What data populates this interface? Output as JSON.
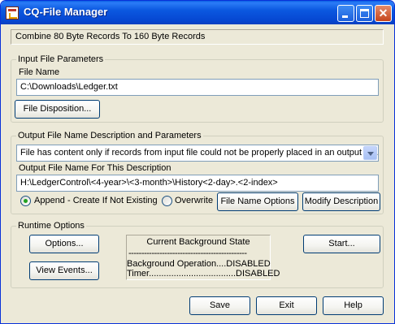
{
  "window": {
    "title": "CQ-File Manager",
    "controls": {
      "minimize": "minimize",
      "maximize": "maximize",
      "close": "✕"
    }
  },
  "status_text": "Combine 80 Byte Records To 160 Byte Records",
  "input_file": {
    "group_title": "Input File Parameters",
    "file_name_label": "File Name",
    "file_name_value": "C:\\Downloads\\Ledger.txt",
    "disposition_button": "File Disposition..."
  },
  "output_file": {
    "group_title": "Output File Name Description and Parameters",
    "description_selected": "File has content only if records from input file could not be properly placed in an output file.",
    "name_label": "Output File Name For This Description",
    "name_value": "H:\\LedgerControl\\<4-year>\\<3-month>\\History<2-day>.<2-index>",
    "radio_append_label": "Append - Create If Not Existing",
    "radio_overwrite_label": "Overwrite",
    "append_selected": true,
    "file_name_options_button": "File Name Options",
    "modify_description_button": "Modify Description"
  },
  "runtime": {
    "group_title": "Runtime Options",
    "options_button": "Options...",
    "view_events_button": "View Events...",
    "start_button": "Start...",
    "state_title": "Current Background State",
    "state_separator": "----------------------------------------------",
    "state_line1": "Background Operation....DISABLED",
    "state_line2": "Timer...................................DISABLED"
  },
  "footer": {
    "save_button": "Save",
    "exit_button": "Exit",
    "help_button": "Help"
  }
}
